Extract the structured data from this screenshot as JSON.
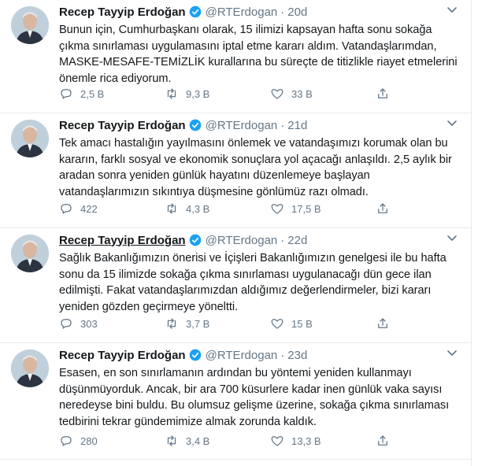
{
  "colors": {
    "accent": "#1da1f2",
    "muted": "#657786",
    "border": "#e6ecf0"
  },
  "icons": {
    "verified": "verified-badge-icon",
    "caret": "chevron-down-icon",
    "reply": "reply-icon",
    "retweet": "retweet-icon",
    "like": "heart-icon",
    "share": "share-icon"
  },
  "tweets": [
    {
      "name": "Recep Tayyip Erdoğan",
      "handle": "@RTErdogan",
      "separator": "·",
      "time": "20d",
      "text": "Bunun için, Cumhurbaşkanı olarak, 15 ilimizi kapsayan hafta sonu sokağa çıkma sınırlaması uygulamasını iptal etme kararı aldım. Vatandaşlarımdan, MASKE-MESAFE-TEMİZLİK kurallarına bu süreçte de titizlikle riayet etmelerini önemle rica ediyorum.",
      "replies": "2,5 B",
      "retweets": "9,3 B",
      "likes": "33 B"
    },
    {
      "name": "Recep Tayyip Erdoğan",
      "handle": "@RTErdogan",
      "separator": "·",
      "time": "21d",
      "text": "Tek amacı hastalığın yayılmasını önlemek ve vatandaşımızı korumak olan bu kararın, farklı sosyal ve ekonomik sonuçlara yol açacağı anlaşıldı. 2,5 aylık bir aradan sonra yeniden günlük hayatını düzenlemeye başlayan vatandaşlarımızın sıkıntıya düşmesine gönlümüz razı olmadı.",
      "replies": "422",
      "retweets": "4,3 B",
      "likes": "17,5 B"
    },
    {
      "name": "Recep Tayyip Erdoğan",
      "handle": "@RTErdogan",
      "separator": "·",
      "time": "22d",
      "text": "Sağlık Bakanlığımızın önerisi ve İçişleri Bakanlığımızın genelgesi ile bu hafta sonu da 15 ilimizde sokağa çıkma sınırlaması uygulanacağı dün gece ilan edilmişti. Fakat vatandaşlarımızdan aldığımız değerlendirmeler, bizi kararı yeniden gözden geçirmeye yöneltti.",
      "replies": "303",
      "retweets": "3,7 B",
      "likes": "15 B"
    },
    {
      "name": "Recep Tayyip Erdoğan",
      "handle": "@RTErdogan",
      "separator": "·",
      "time": "23d",
      "text": "Esasen, en son sınırlamanın ardından bu yöntemi yeniden kullanmayı düşünmüyorduk. Ancak, bir ara 700 küsurlere kadar inen günlük vaka sayısı neredeyse bini buldu. Bu olumsuz gelişme üzerine, sokağa çıkma sınırlaması tedbirini tekrar gündemimize almak zorunda kaldık.",
      "replies": "280",
      "retweets": "3,4 B",
      "likes": "13,3 B"
    }
  ]
}
